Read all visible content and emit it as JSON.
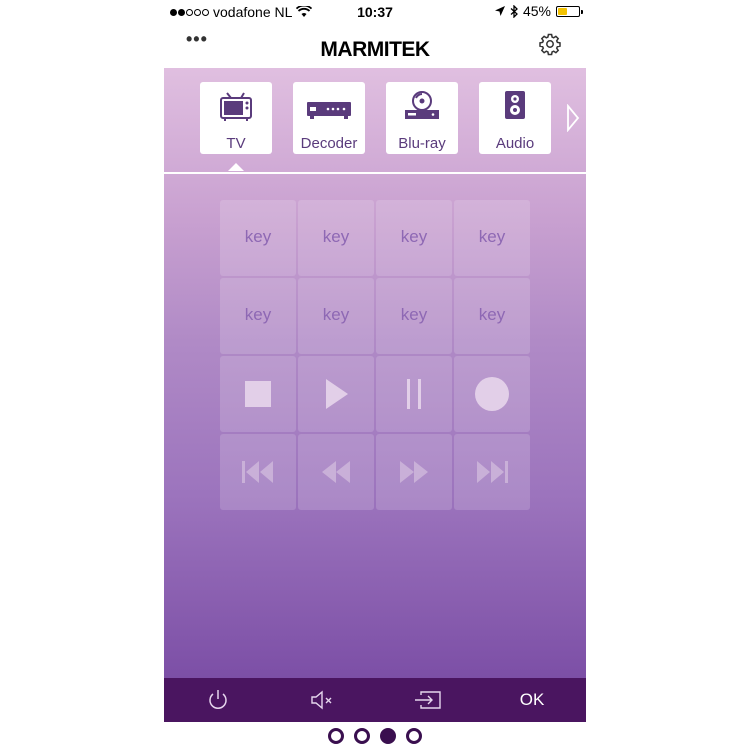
{
  "status_bar": {
    "carrier": "vodafone NL",
    "time": "10:37",
    "battery_percent": "45%",
    "battery_level": 0.45,
    "signal_bars_filled": 2,
    "signal_bars_total": 5
  },
  "header": {
    "brand": "MARMITEK",
    "menu_icon": "more-dots-icon",
    "settings_icon": "gear-icon"
  },
  "devices": [
    {
      "label": "TV",
      "icon": "tv-icon",
      "selected": true
    },
    {
      "label": "Decoder",
      "icon": "decoder-icon",
      "selected": false
    },
    {
      "label": "Blu-ray",
      "icon": "bluray-icon",
      "selected": false
    },
    {
      "label": "Audio",
      "icon": "speaker-icon",
      "selected": false
    }
  ],
  "keypad": {
    "key_label": "key",
    "keys": [
      "key",
      "key",
      "key",
      "key",
      "key",
      "key",
      "key",
      "key"
    ],
    "transport": [
      "stop-icon",
      "play-icon",
      "pause-icon",
      "record-icon"
    ],
    "navigation": [
      "skip-back-icon",
      "rewind-icon",
      "fast-forward-icon",
      "skip-forward-icon"
    ]
  },
  "bottom_bar": {
    "buttons": [
      "power-icon",
      "mute-icon",
      "input-icon"
    ],
    "ok_label": "OK"
  },
  "pager": {
    "total_pages": 4,
    "current_page": 3
  },
  "colors": {
    "gradient_top": "#e0bfe0",
    "gradient_bottom": "#7c4fa6",
    "bottom_bar": "#4a1560",
    "device_label": "#5a3b7c",
    "key_text": "#8e68b4",
    "battery_fill": "#f2c200"
  }
}
